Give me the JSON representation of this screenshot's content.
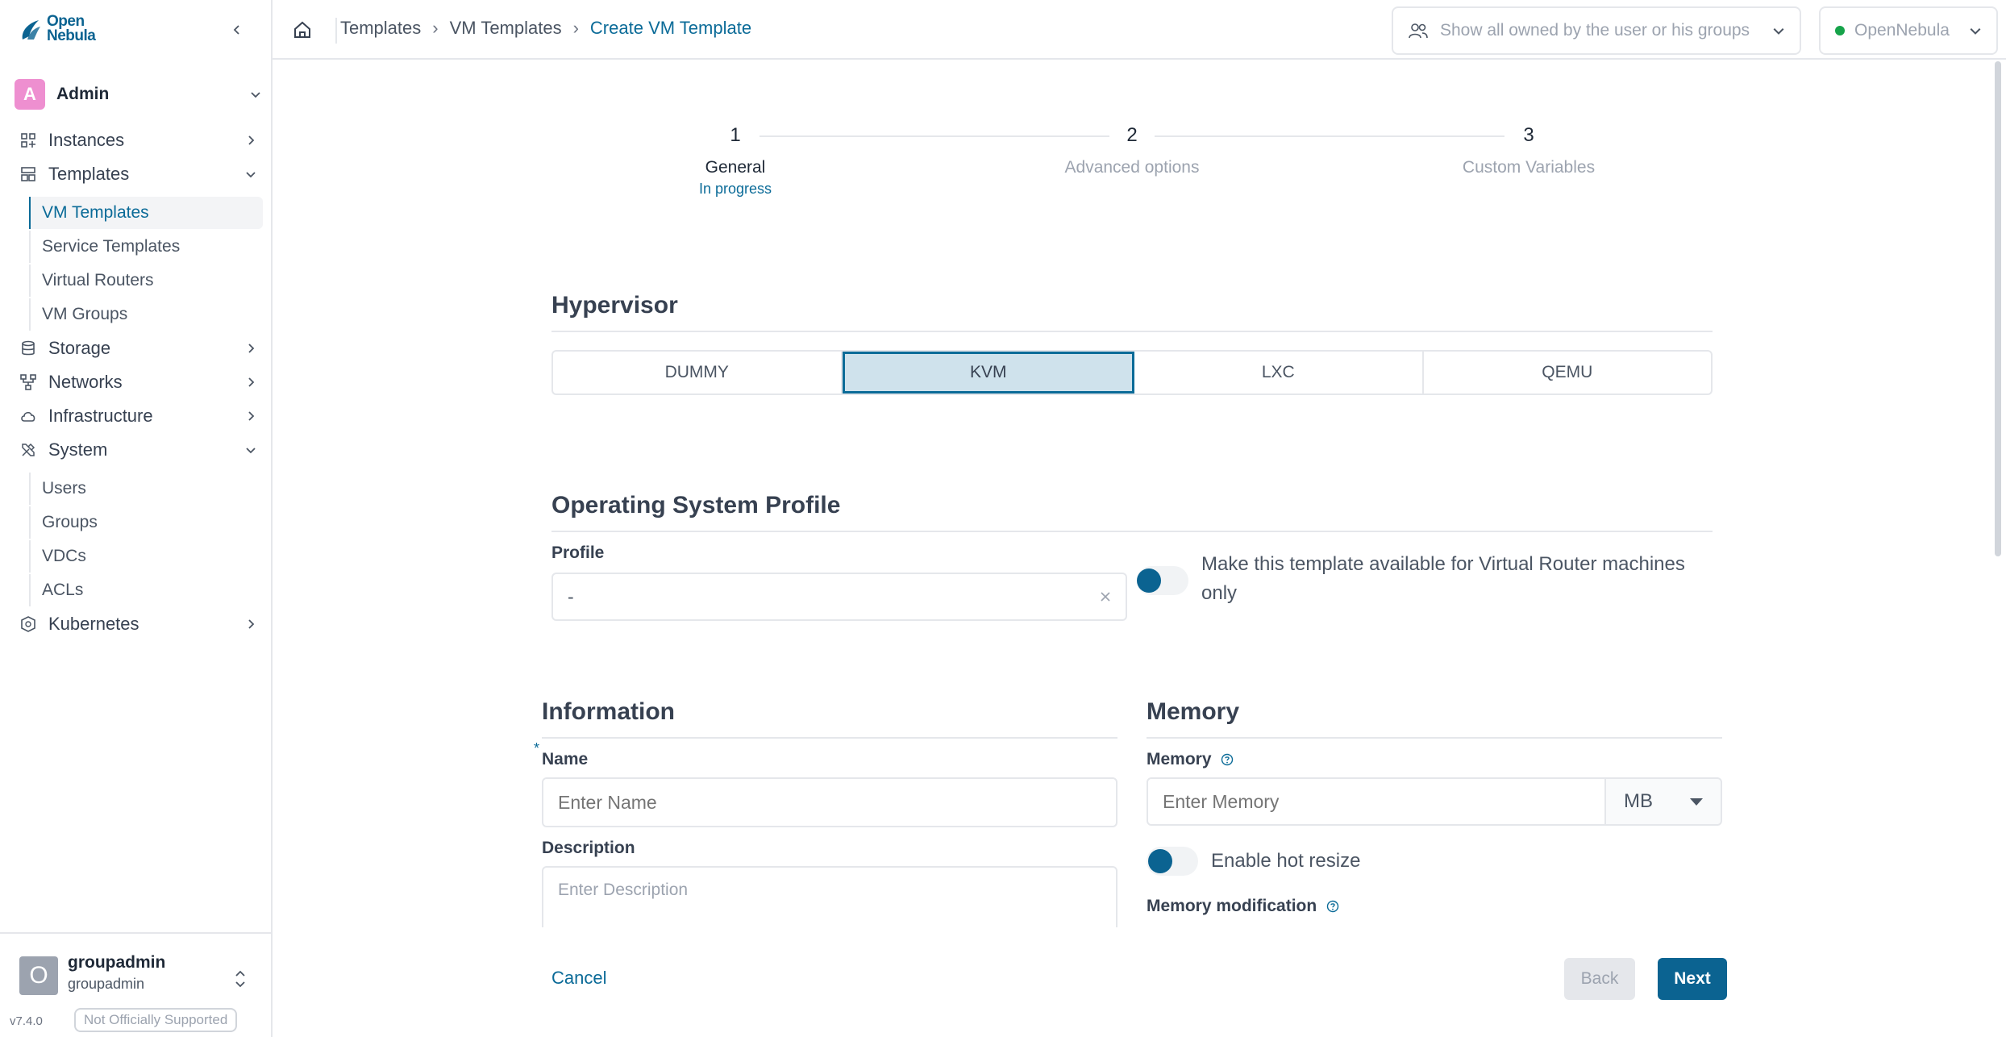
{
  "brand": {
    "logo_line1": "Open",
    "logo_line2": "Nebula"
  },
  "sidebar": {
    "group_badge": "A",
    "group_name": "Admin",
    "nav": {
      "instances": "Instances",
      "templates": "Templates",
      "storage": "Storage",
      "networks": "Networks",
      "infrastructure": "Infrastructure",
      "system": "System",
      "kubernetes": "Kubernetes"
    },
    "templates_sub": [
      "VM Templates",
      "Service Templates",
      "Virtual Routers",
      "VM Groups"
    ],
    "system_sub": [
      "Users",
      "Groups",
      "VDCs",
      "ACLs"
    ],
    "footer": {
      "avatar_letter": "O",
      "user_name": "groupadmin",
      "user_group": "groupadmin",
      "version": "v7.4.0",
      "support_badge": "Not Officially Supported"
    }
  },
  "header": {
    "breadcrumb": [
      "Templates",
      "VM Templates",
      "Create VM Template"
    ],
    "filter_text": "Show all owned by the user or his groups",
    "zone": "OpenNebula",
    "zone_status_color": "#16a34a"
  },
  "stepper": {
    "steps": [
      {
        "number": "1",
        "label": "General",
        "status": "In progress"
      },
      {
        "number": "2",
        "label": "Advanced options",
        "status": ""
      },
      {
        "number": "3",
        "label": "Custom Variables",
        "status": ""
      }
    ]
  },
  "hypervisor": {
    "title": "Hypervisor",
    "options": [
      "DUMMY",
      "KVM",
      "LXC",
      "QEMU"
    ],
    "selected": "KVM"
  },
  "os_profile": {
    "title": "Operating System Profile",
    "profile_label": "Profile",
    "profile_value": "-",
    "virtual_router_toggle_text": "Make this template available for Virtual Router machines only",
    "virtual_router_toggle_on": false
  },
  "information": {
    "title": "Information",
    "required_mark": "*",
    "name_label": "Name",
    "name_placeholder": "Enter Name",
    "description_label": "Description",
    "description_placeholder": "Enter Description"
  },
  "memory": {
    "title": "Memory",
    "memory_label": "Memory",
    "memory_placeholder": "Enter Memory",
    "unit": "MB",
    "hot_resize_text": "Enable hot resize",
    "hot_resize_on": false,
    "modification_label": "Memory modification"
  },
  "actions": {
    "cancel": "Cancel",
    "back": "Back",
    "next": "Next"
  },
  "colors": {
    "accent": "#0b6391",
    "link": "#0b6b98",
    "badge": "#ee8fd0"
  }
}
